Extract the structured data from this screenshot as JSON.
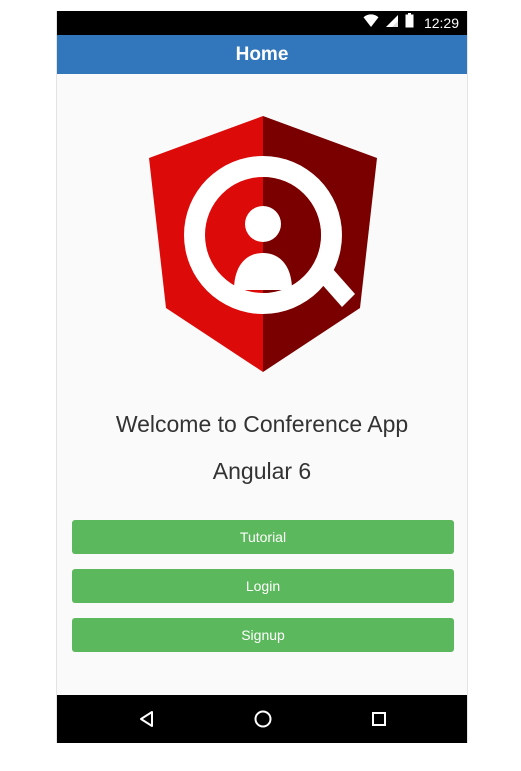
{
  "status_bar": {
    "time": "12:29",
    "icons": [
      "wifi-icon",
      "signal-icon",
      "battery-icon"
    ]
  },
  "header": {
    "title": "Home"
  },
  "logo": {
    "name": "conference-app-logo",
    "colors": {
      "left": "#dd0a0a",
      "right": "#7a0000",
      "inner": "#ffffff"
    }
  },
  "welcome": {
    "line1": "Welcome to Conference App",
    "line2": "Angular 6"
  },
  "buttons": {
    "tutorial": "Tutorial",
    "login": "Login",
    "signup": "Signup"
  },
  "colors": {
    "header_bg": "#3277bb",
    "button_bg": "#5cb85c",
    "status_bar_bg": "#000000",
    "nav_bar_bg": "#000000"
  },
  "navigation": {
    "icons": [
      "back-icon",
      "home-icon",
      "recent-apps-icon"
    ]
  }
}
